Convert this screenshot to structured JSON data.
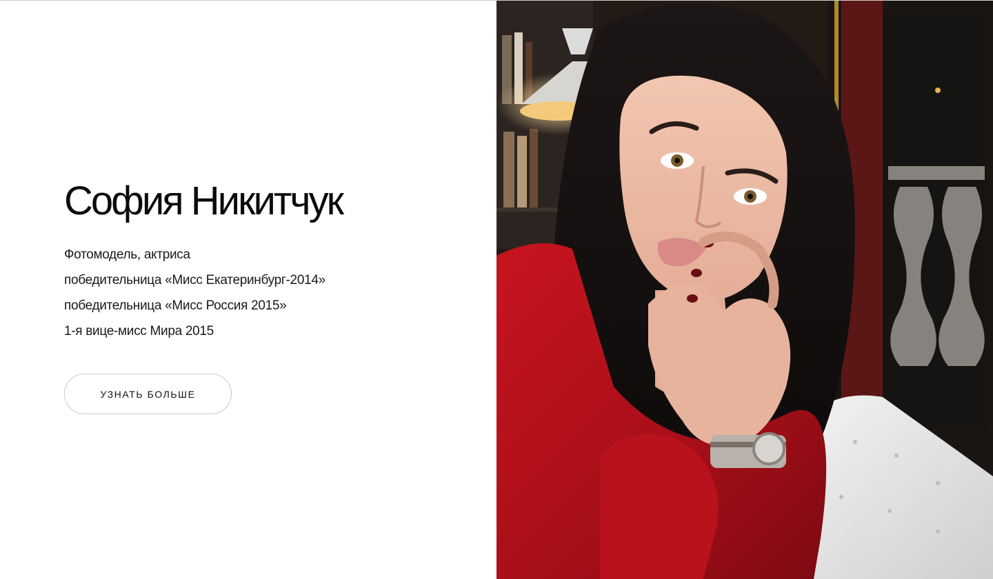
{
  "hero": {
    "name": "София Никитчук",
    "description_lines": [
      "Фотомодель, актриса",
      "победительница «Мисс Екатеринбург-2014»",
      "победительница «Мисс Россия 2015»",
      "1-я вице-мисс Мира 2015"
    ],
    "button_label": "УЗНАТЬ БОЛЬШЕ"
  },
  "photo": {
    "alt": "София Никитчук"
  },
  "colors": {
    "background": "#ffffff",
    "text": "#111111",
    "button_border": "#c9c9c9",
    "dress_red": "#b3121b",
    "sofa_white": "#e9e9e9"
  }
}
